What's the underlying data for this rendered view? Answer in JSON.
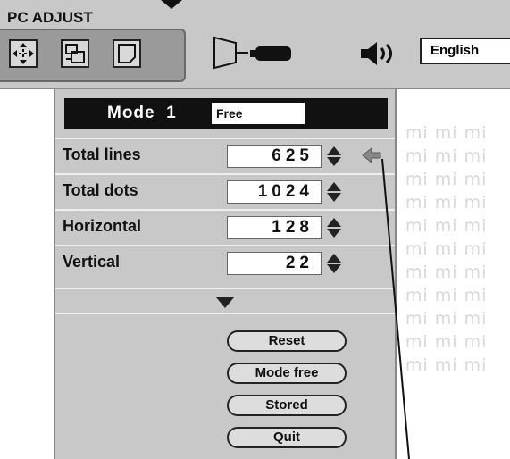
{
  "title": "PC ADJUST",
  "toolbar": {
    "language": "English",
    "icons": [
      "position-icon",
      "pc-adjust-icon",
      "image-icon",
      "screen-icon",
      "volume-icon"
    ]
  },
  "mode": {
    "label": "Mode",
    "number": "1",
    "value": "Free"
  },
  "rows": [
    {
      "label": "Total lines",
      "value": "625"
    },
    {
      "label": "Total dots",
      "value": "1024"
    },
    {
      "label": "Horizontal",
      "value": "128"
    },
    {
      "label": "Vertical",
      "value": "22"
    }
  ],
  "buttons": {
    "reset": "Reset",
    "mode_free": "Mode free",
    "stored": "Stored",
    "quit": "Quit"
  }
}
